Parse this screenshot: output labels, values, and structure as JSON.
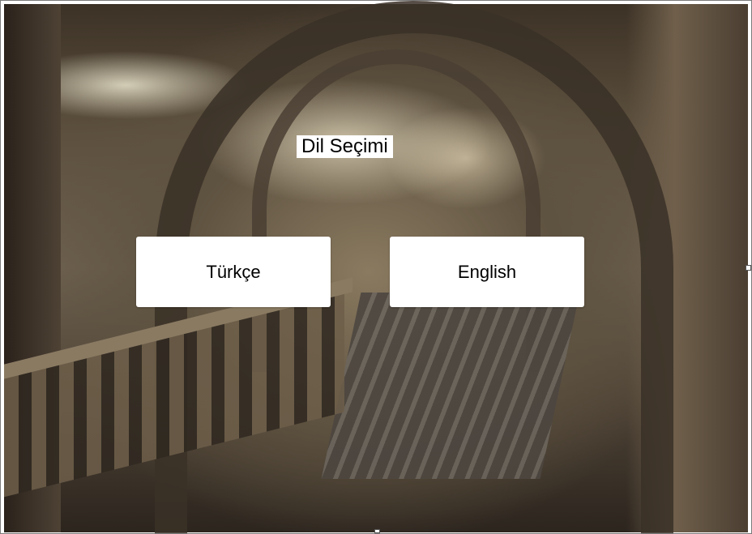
{
  "window": {
    "title": "Dil Seçimi"
  },
  "background": {
    "image": "museum-hall-photo"
  },
  "buttons": {
    "turkish_label": "Türkçe",
    "english_label": "English"
  },
  "colors": {
    "button_background": "#ffffff",
    "text": "#000000"
  }
}
